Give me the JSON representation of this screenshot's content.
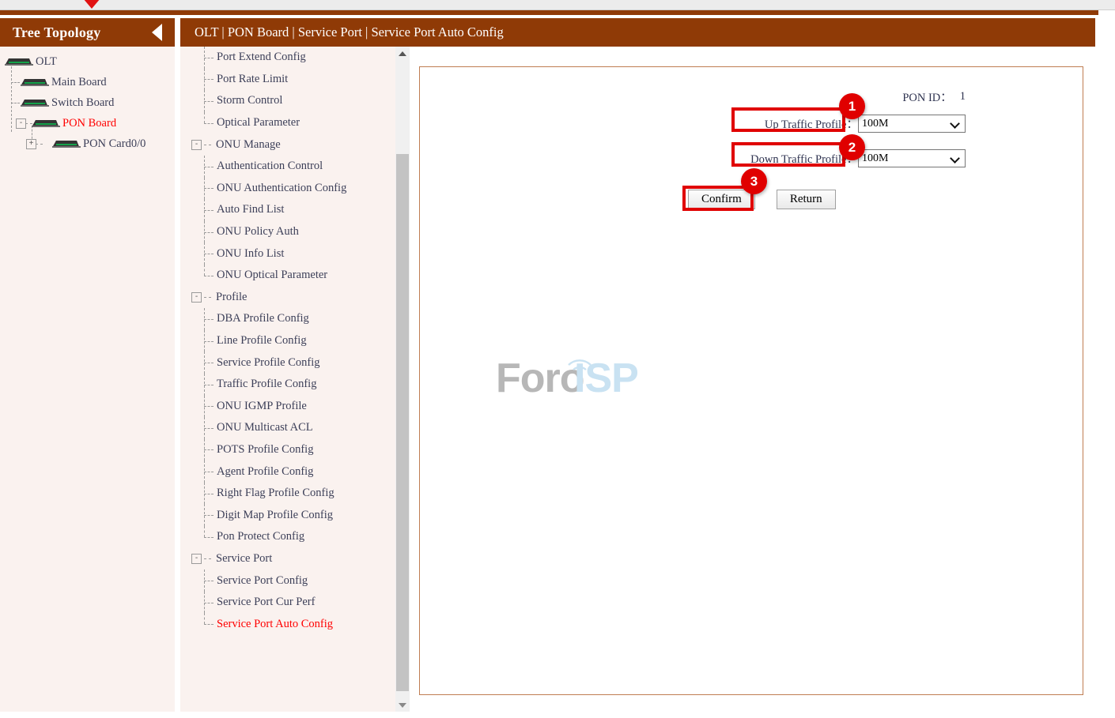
{
  "header": {
    "breadcrumb": "OLT | PON Board | Service Port | Service Port Auto Config",
    "brand_color": "#8f3a06",
    "accent_red": "#e00000"
  },
  "tree_panel": {
    "title": "Tree Topology",
    "collapse_icon": "triangle-left-icon",
    "nodes": [
      {
        "label": "OLT",
        "level": 0,
        "toggle": "",
        "active": false,
        "icon": "device-icon"
      },
      {
        "label": "Main Board",
        "level": 1,
        "toggle": "",
        "active": false,
        "icon": "device-icon"
      },
      {
        "label": "Switch Board",
        "level": 1,
        "toggle": "",
        "active": false,
        "icon": "device-icon"
      },
      {
        "label": "PON Board",
        "level": 1,
        "toggle": "-",
        "active": true,
        "icon": "device-icon"
      },
      {
        "label": "PON Card0/0",
        "level": 2,
        "toggle": "+",
        "active": false,
        "icon": "device-icon"
      }
    ]
  },
  "menu_panel": {
    "clipped_top_item": "",
    "items": [
      {
        "label": "Port Extend Config",
        "type": "child",
        "active": false
      },
      {
        "label": "Port Rate Limit",
        "type": "child",
        "active": false
      },
      {
        "label": "Storm Control",
        "type": "child",
        "active": false
      },
      {
        "label": "Optical Parameter",
        "type": "child",
        "active": false,
        "last": true
      },
      {
        "label": "ONU Manage",
        "type": "group",
        "toggle": "-",
        "active": false
      },
      {
        "label": "Authentication Control",
        "type": "child",
        "active": false
      },
      {
        "label": "ONU Authentication Config",
        "type": "child",
        "active": false
      },
      {
        "label": "Auto Find List",
        "type": "child",
        "active": false
      },
      {
        "label": "ONU Policy Auth",
        "type": "child",
        "active": false
      },
      {
        "label": "ONU Info List",
        "type": "child",
        "active": false
      },
      {
        "label": "ONU Optical Parameter",
        "type": "child",
        "active": false,
        "last": true
      },
      {
        "label": "Profile",
        "type": "group",
        "toggle": "-",
        "active": false
      },
      {
        "label": "DBA Profile Config",
        "type": "child",
        "active": false
      },
      {
        "label": "Line Profile Config",
        "type": "child",
        "active": false
      },
      {
        "label": "Service Profile Config",
        "type": "child",
        "active": false
      },
      {
        "label": "Traffic Profile Config",
        "type": "child",
        "active": false
      },
      {
        "label": "ONU IGMP Profile",
        "type": "child",
        "active": false
      },
      {
        "label": "ONU Multicast ACL",
        "type": "child",
        "active": false
      },
      {
        "label": "POTS Profile Config",
        "type": "child",
        "active": false
      },
      {
        "label": "Agent Profile Config",
        "type": "child",
        "active": false
      },
      {
        "label": "Right Flag Profile Config",
        "type": "child",
        "active": false
      },
      {
        "label": "Digit Map Profile Config",
        "type": "child",
        "active": false
      },
      {
        "label": "Pon Protect Config",
        "type": "child",
        "active": false,
        "last": true
      },
      {
        "label": "Service Port",
        "type": "group",
        "toggle": "-",
        "active": false
      },
      {
        "label": "Service Port Config",
        "type": "child",
        "active": false
      },
      {
        "label": "Service Port Cur Perf",
        "type": "child",
        "active": false
      },
      {
        "label": "Service Port Auto Config",
        "type": "child",
        "active": true,
        "last": true
      }
    ],
    "scrollbar": {
      "up_icon": "triangle-up-icon",
      "down_icon": "triangle-down-icon"
    }
  },
  "form": {
    "pon_id_label": "PON ID：",
    "pon_id_value": "1",
    "up_profile_label": "Up Traffic Profile：",
    "up_profile_value": "100M",
    "down_profile_label": "Down Traffic Profile：",
    "down_profile_value": "100M",
    "profile_options": [
      "100M"
    ],
    "confirm_label": "Confirm",
    "return_label": "Return",
    "dropdown_icon": "chevron-down-icon"
  },
  "annotations": [
    {
      "number": "1",
      "target": "up-traffic-profile-select"
    },
    {
      "number": "2",
      "target": "down-traffic-profile-select"
    },
    {
      "number": "3",
      "target": "confirm-button"
    }
  ],
  "watermark": {
    "text_primary": "Foro",
    "text_secondary": "ISP",
    "color_primary": "#b7b7b7",
    "color_secondary": "#c9e2f2"
  }
}
